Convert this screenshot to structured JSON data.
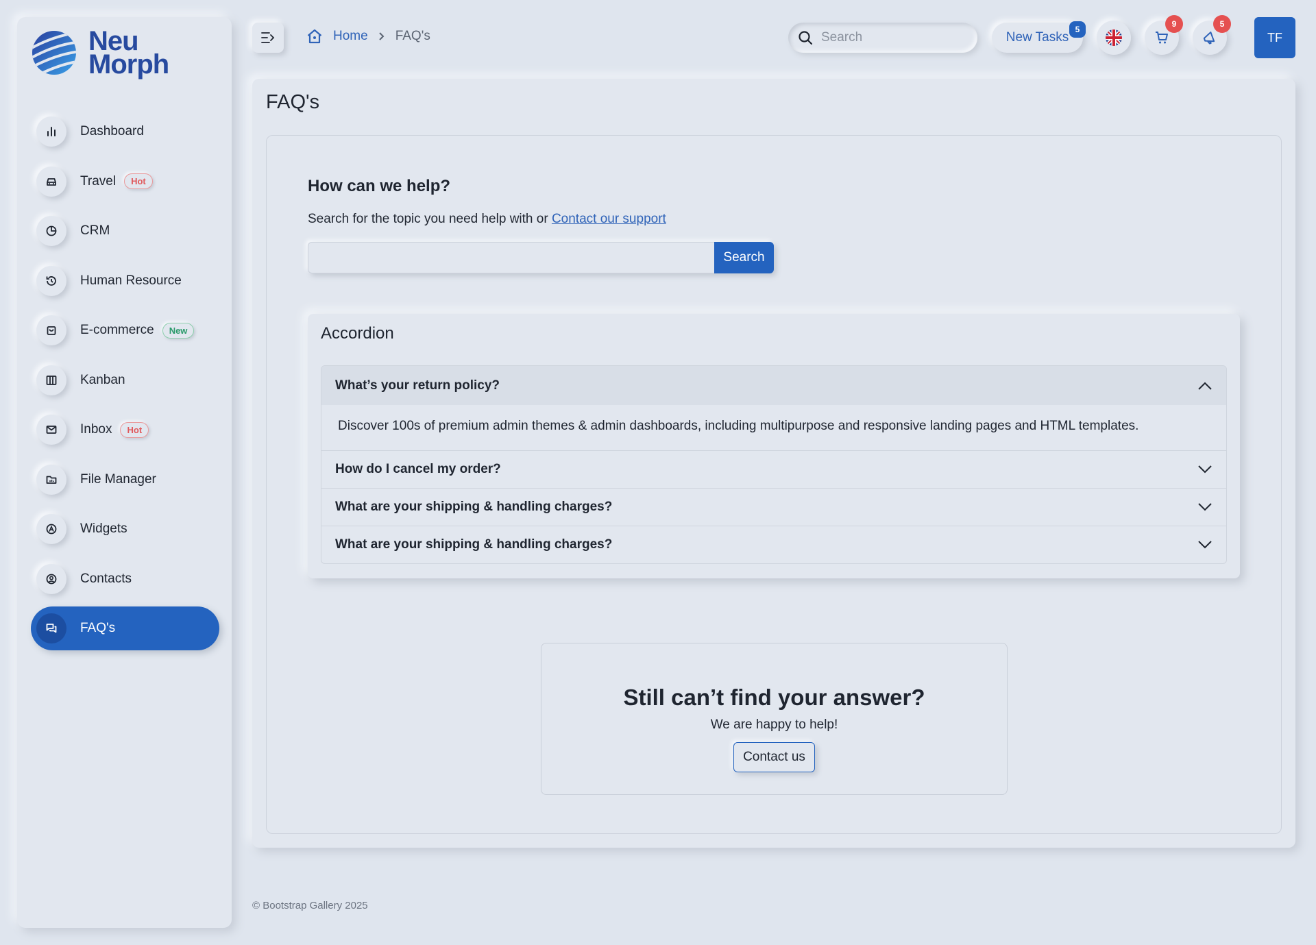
{
  "brand": {
    "line1": "Neu",
    "line2": "Morph"
  },
  "sidebar": {
    "items": [
      {
        "label": "Dashboard",
        "icon": "bar-chart-icon"
      },
      {
        "label": "Travel",
        "icon": "car-icon",
        "badge": "Hot"
      },
      {
        "label": "CRM",
        "icon": "pie-chart-icon"
      },
      {
        "label": "Human Resource",
        "icon": "history-icon"
      },
      {
        "label": "E-commerce",
        "icon": "bag-icon",
        "badge": "New"
      },
      {
        "label": "Kanban",
        "icon": "columns-icon"
      },
      {
        "label": "Inbox",
        "icon": "mail-icon",
        "badge": "Hot"
      },
      {
        "label": "File Manager",
        "icon": "folder-icon"
      },
      {
        "label": "Widgets",
        "icon": "widgets-icon"
      },
      {
        "label": "Contacts",
        "icon": "user-circle-icon"
      },
      {
        "label": "FAQ's",
        "icon": "chat-icon",
        "active": true
      }
    ]
  },
  "header": {
    "breadcrumb": {
      "home": "Home",
      "current": "FAQ's"
    },
    "search_placeholder": "Search",
    "tasks_label": "New Tasks",
    "tasks_count": "5",
    "cart_count": "9",
    "notif_count": "5",
    "avatar_initials": "TF"
  },
  "page": {
    "title": "FAQ's",
    "help_title": "How can we help?",
    "help_sub": "Search for the topic you need help with or",
    "help_link": "Contact our support",
    "search_button": "Search",
    "accordion_title": "Accordion",
    "faqs": [
      {
        "question": "What’s your return policy?",
        "answer": "Discover 100s of premium admin themes & admin dashboards, including multipurpose and responsive landing pages and HTML templates.",
        "open": true
      },
      {
        "question": "How do I cancel my order?",
        "open": false
      },
      {
        "question": "What are your shipping & handling charges?",
        "open": false
      },
      {
        "question": "What are your shipping & handling charges?",
        "open": false
      }
    ],
    "cta_title": "Still can’t find your answer?",
    "cta_sub": "We are happy to help!",
    "cta_button": "Contact us"
  },
  "footer": {
    "text": "© Bootstrap Gallery 2025"
  },
  "colors": {
    "accent": "#2463bf",
    "background": "#dfe5ee",
    "hot": "#e0595c",
    "new": "#2a9a6a",
    "danger": "#e55050"
  }
}
